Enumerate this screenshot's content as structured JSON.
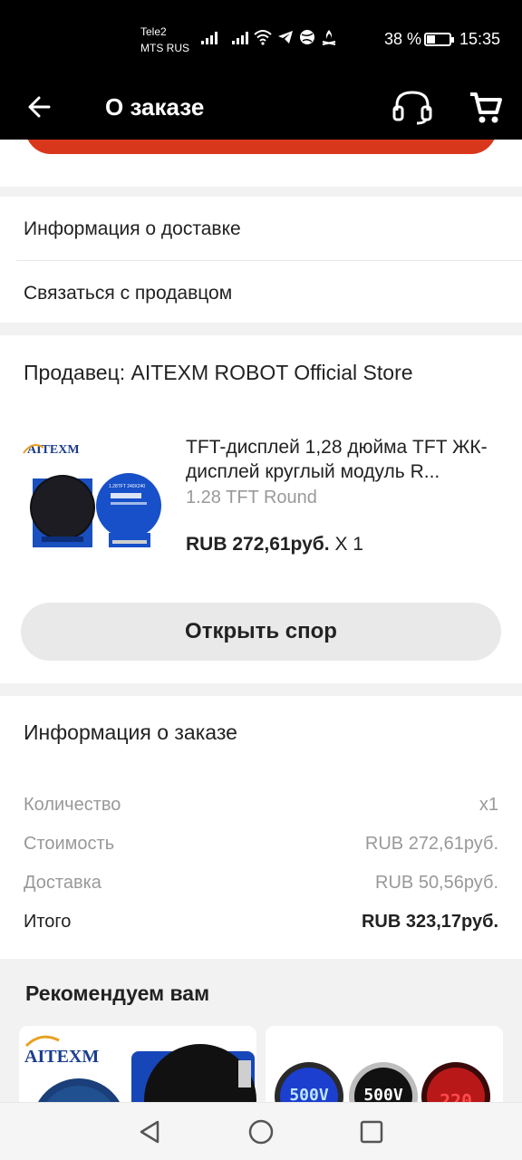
{
  "status": {
    "carrier1": "Tele2",
    "carrier2": "MTS RUS",
    "battery_text": "38 %",
    "battery_level": 0.38,
    "time": "15:35"
  },
  "header": {
    "title": "О заказе",
    "icons": [
      "back-arrow-icon",
      "headset-icon",
      "cart-icon"
    ]
  },
  "links": {
    "delivery_info": "Информация о доставке",
    "contact_seller": "Связаться с продавцом"
  },
  "seller": {
    "label": "Продавец: AITEXM ROBOT Official Store",
    "logo_text": "AITEXM"
  },
  "product": {
    "title": "TFT-дисплей 1,28 дюйма TFT ЖК-дисплей круглый модуль R...",
    "variant": "1.28 TFT Round",
    "price": "RUB 272,61руб.",
    "qty": "X 1"
  },
  "dispute_button": "Открыть спор",
  "order_info": {
    "title": "Информация о заказе",
    "rows": [
      {
        "label": "Количество",
        "value": "x1"
      },
      {
        "label": "Стоимость",
        "value": "RUB 272,61руб."
      },
      {
        "label": "Доставка",
        "value": "RUB 50,56руб."
      }
    ],
    "total": {
      "label": "Итого",
      "value": "RUB 323,17руб."
    }
  },
  "recommend": {
    "title": "Рекомендуем вам",
    "card1_logo": "AITEXM",
    "card2_readings": [
      "500V",
      "500V",
      "220"
    ]
  },
  "colors": {
    "accent": "#d9371c",
    "appbar": "#000000"
  }
}
